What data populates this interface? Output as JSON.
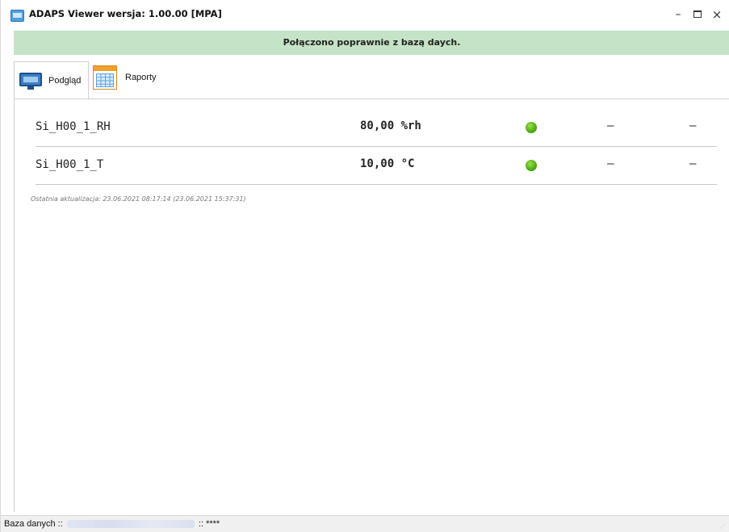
{
  "window": {
    "title": "ADAPS Viewer wersja: 1.00.00 [MPA]",
    "minimize": "–",
    "close": "×"
  },
  "banner": {
    "text": "Połączono poprawnie z bazą daych."
  },
  "tabs": [
    {
      "label": "Podgląd",
      "icon": "monitor-icon",
      "active": true
    },
    {
      "label": "Raporty",
      "icon": "calendar-icon",
      "active": false
    }
  ],
  "sensors": [
    {
      "name": "Si_H00_1_RH",
      "value": "80,00 %rh",
      "status": "green",
      "col1": "–",
      "col2": "–"
    },
    {
      "name": "Si_H00_1_T",
      "value": "10,00 °C",
      "status": "green",
      "col1": "–",
      "col2": "–"
    }
  ],
  "last_update": "Ostatnia aktualizacja: 23.06.2021 08:17:14 (23.06.2021 15:37:31)",
  "statusbar": {
    "prefix": "Baza danych ::",
    "suffix": ":: ****"
  },
  "colors": {
    "banner_bg": "#c5e3c6",
    "status_ok": "#4fb014"
  }
}
